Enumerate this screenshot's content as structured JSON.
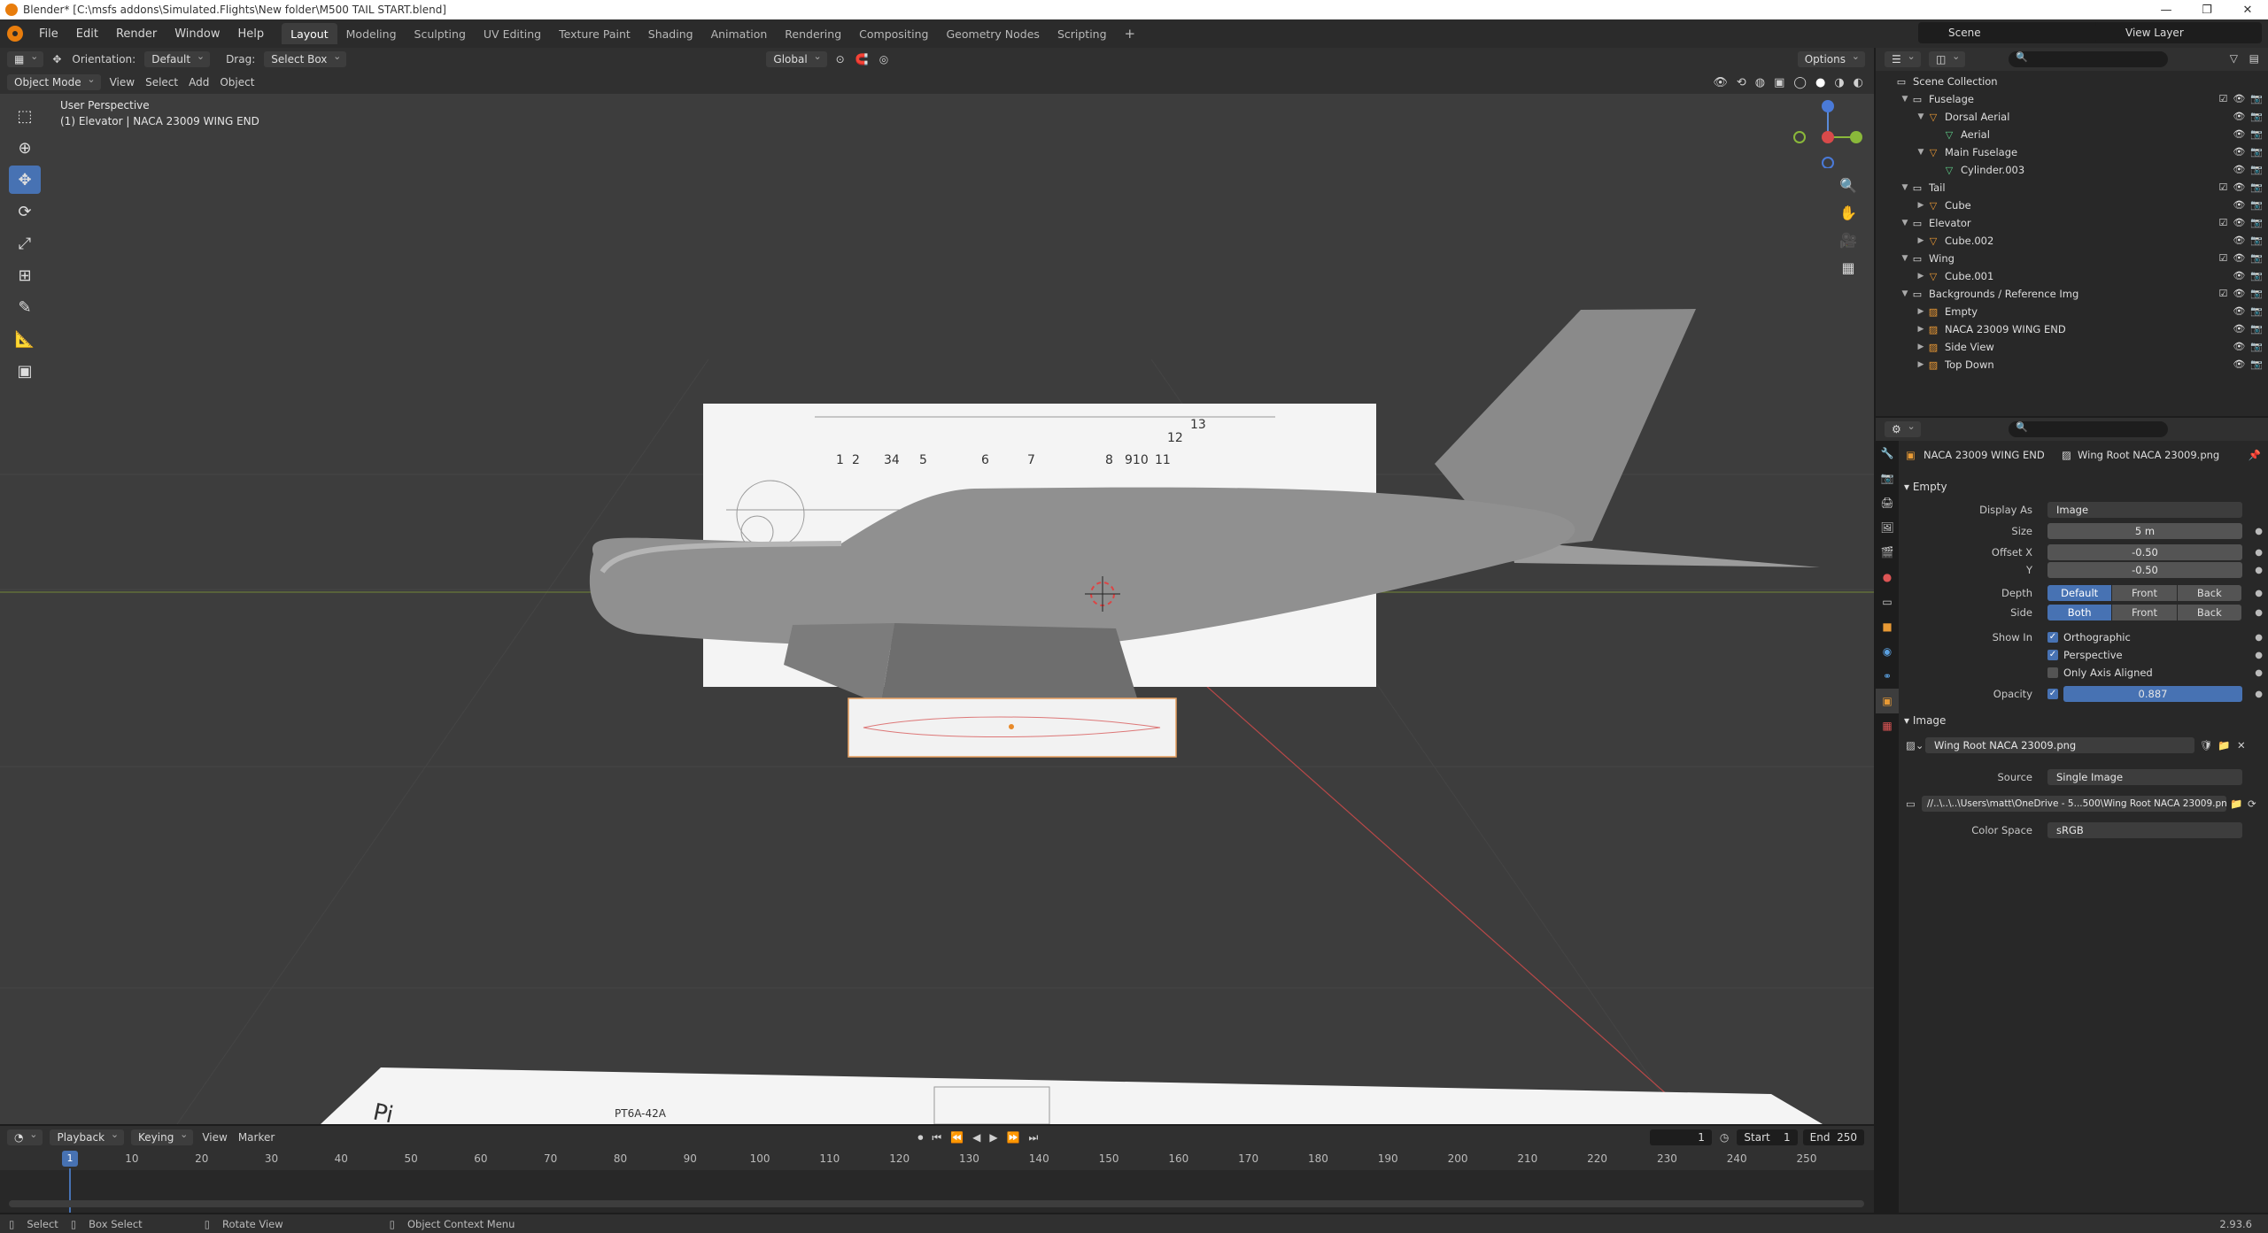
{
  "window": {
    "title": "Blender* [C:\\msfs addons\\Simulated.Flights\\New folder\\M500 TAIL START.blend]",
    "controls": [
      "—",
      "❐",
      "✕"
    ]
  },
  "menu": [
    "File",
    "Edit",
    "Render",
    "Window",
    "Help"
  ],
  "workspaces": [
    "Layout",
    "Modeling",
    "Sculpting",
    "UV Editing",
    "Texture Paint",
    "Shading",
    "Animation",
    "Rendering",
    "Compositing",
    "Geometry Nodes",
    "Scripting",
    "+"
  ],
  "active_workspace": "Layout",
  "scene": {
    "name": "Scene",
    "view_layer": "View Layer"
  },
  "tool_header": {
    "orientation_label": "Orientation:",
    "orientation_value": "Default",
    "drag_label": "Drag:",
    "drag_value": "Select Box",
    "transform_orientation": "Global",
    "options": "Options"
  },
  "viewport_header": {
    "mode": "Object Mode",
    "menus": [
      "View",
      "Select",
      "Add",
      "Object"
    ]
  },
  "viewport": {
    "view_name": "User Perspective",
    "object_info": "(1) Elevator | NACA 23009 WING END",
    "sheet_numbers": [
      "1",
      "2",
      "34",
      "5",
      "6",
      "7",
      "8",
      "910",
      "11",
      "12",
      "13"
    ],
    "ground_sheet_text": "PT6A-42A",
    "ground_sheet_letter": "Pi"
  },
  "timeline": {
    "menus": [
      "Playback",
      "Keying",
      "View",
      "Marker"
    ],
    "current_frame": "1",
    "start_label": "Start",
    "start": "1",
    "end_label": "End",
    "end": "250",
    "ticks": [
      "10",
      "20",
      "30",
      "40",
      "50",
      "60",
      "70",
      "80",
      "90",
      "100",
      "110",
      "120",
      "130",
      "140",
      "150",
      "160",
      "170",
      "180",
      "190",
      "200",
      "210",
      "220",
      "230",
      "240",
      "250"
    ]
  },
  "status_bar": {
    "items": [
      "Select",
      "Box Select",
      "Rotate View",
      "Object Context Menu"
    ],
    "version": "2.93.6"
  },
  "outliner": {
    "rows": [
      {
        "label": "Scene Collection",
        "indent": 0,
        "icon": "collection-icon",
        "tri": ""
      },
      {
        "label": "Fuselage",
        "indent": 1,
        "icon": "collection-icon",
        "tri": "▼"
      },
      {
        "label": "Dorsal Aerial",
        "indent": 2,
        "icon": "object-icon",
        "tri": "▼"
      },
      {
        "label": "Aerial",
        "indent": 3,
        "icon": "mesh-icon",
        "tri": ""
      },
      {
        "label": "Main Fuselage",
        "indent": 2,
        "icon": "object-icon",
        "tri": "▼"
      },
      {
        "label": "Cylinder.003",
        "indent": 3,
        "icon": "mesh-icon",
        "tri": ""
      },
      {
        "label": "Tail",
        "indent": 1,
        "icon": "collection-icon",
        "tri": "▼"
      },
      {
        "label": "Cube",
        "indent": 2,
        "icon": "object-icon",
        "tri": "▶"
      },
      {
        "label": "Elevator",
        "indent": 1,
        "icon": "collection-icon",
        "tri": "▼"
      },
      {
        "label": "Cube.002",
        "indent": 2,
        "icon": "object-icon",
        "tri": "▶"
      },
      {
        "label": "Wing",
        "indent": 1,
        "icon": "collection-icon",
        "tri": "▼"
      },
      {
        "label": "Cube.001",
        "indent": 2,
        "icon": "object-icon",
        "tri": "▶"
      },
      {
        "label": "Backgrounds / Reference Img",
        "indent": 1,
        "icon": "collection-icon",
        "tri": "▼"
      },
      {
        "label": "Empty",
        "indent": 2,
        "icon": "image-empty-icon",
        "tri": "▶"
      },
      {
        "label": "NACA 23009 WING END",
        "indent": 2,
        "icon": "image-empty-icon",
        "tri": "▶"
      },
      {
        "label": "Side View",
        "indent": 2,
        "icon": "image-empty-icon",
        "tri": "▶"
      },
      {
        "label": "Top Down",
        "indent": 2,
        "icon": "image-empty-icon",
        "tri": "▶"
      }
    ]
  },
  "properties": {
    "object_name": "NACA 23009 WING END",
    "image_name": "Wing Root NACA 23009.png",
    "empty_panel": "Empty",
    "display_as_label": "Display As",
    "display_as": "Image",
    "size_label": "Size",
    "size": "5 m",
    "offset_x_label": "Offset X",
    "offset_x": "-0.50",
    "offset_y_label": "Y",
    "offset_y": "-0.50",
    "depth_label": "Depth",
    "depth_options": [
      "Default",
      "Front",
      "Back"
    ],
    "side_label": "Side",
    "side_options": [
      "Both",
      "Front",
      "Back"
    ],
    "show_in_label": "Show In",
    "show_orthographic": "Orthographic",
    "show_perspective": "Perspective",
    "only_axis_aligned": "Only Axis Aligned",
    "opacity_label": "Opacity",
    "opacity": "0.887",
    "image_panel": "Image",
    "image_datablock": "Wing Root NACA 23009.png",
    "source_label": "Source",
    "source": "Single Image",
    "filepath": "//..\\..\\..\\Users\\matt\\OneDrive - 5...500\\Wing Root NACA 23009.png",
    "color_space_label": "Color Space",
    "color_space": "sRGB"
  },
  "colors": {
    "accent": "#4772b3",
    "background": "#3d3d3d",
    "panel": "#282828",
    "blender_orange": "#e87d0d"
  }
}
